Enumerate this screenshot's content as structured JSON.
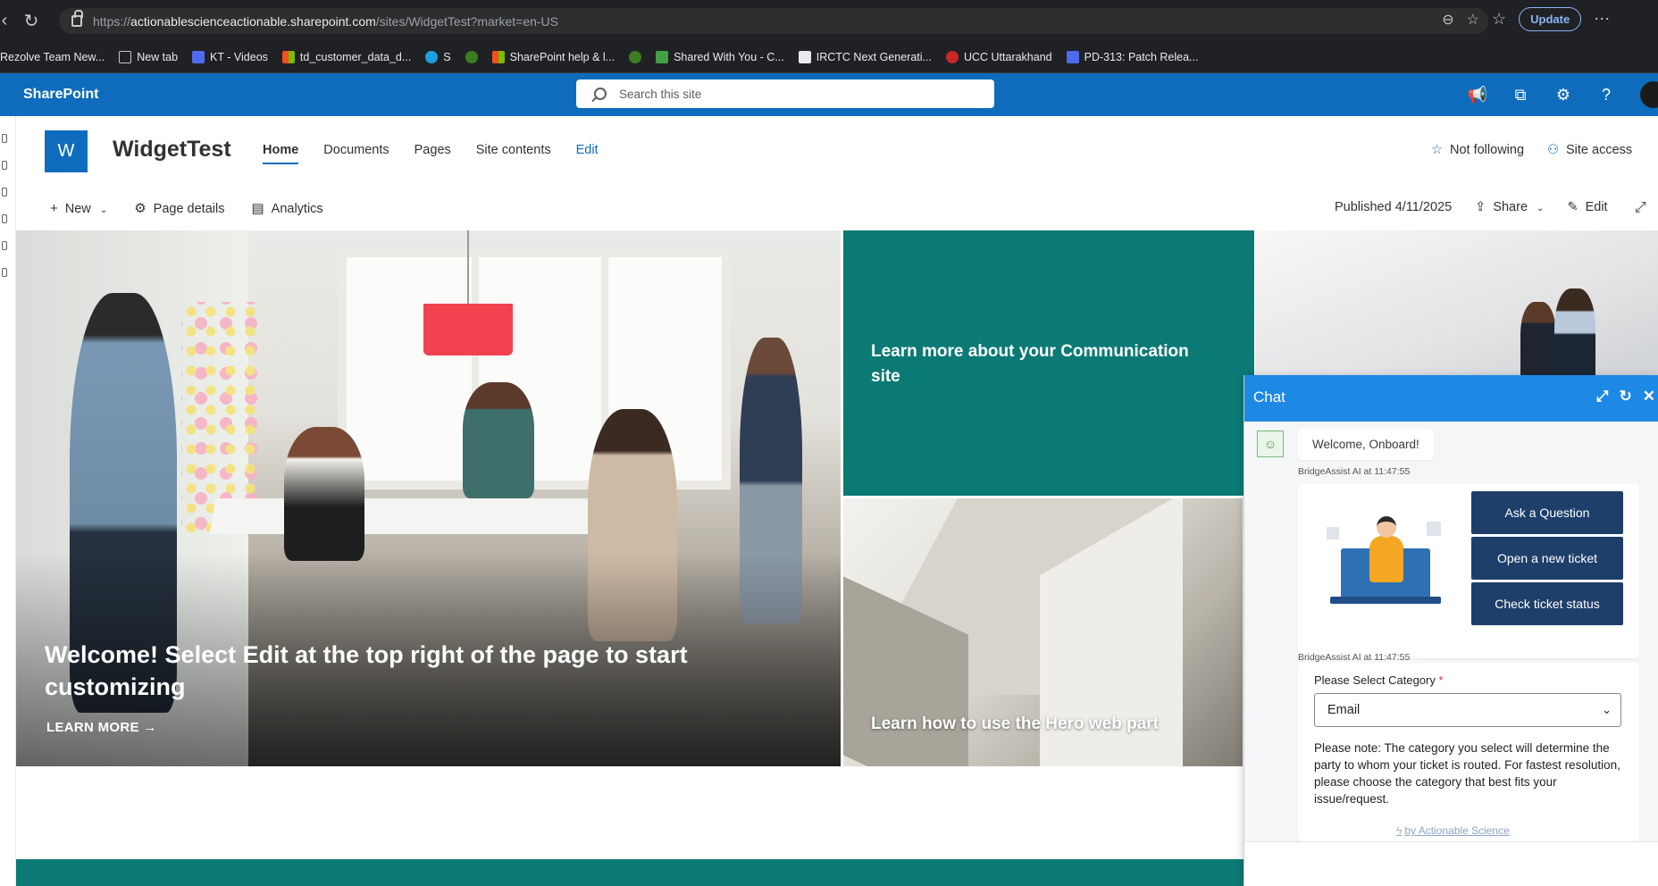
{
  "browser": {
    "url_prefix": "https://",
    "url_host": "actionablescienceactionable.sharepoint.com",
    "url_path": "/sites/WidgetTest?market=en-US",
    "update_label": "Update",
    "bookmarks": [
      {
        "label": "Rezolve Team New...",
        "color": "#4f6bed"
      },
      {
        "label": "New tab",
        "color": "#5f6368"
      },
      {
        "label": "KT - Videos",
        "color": "#4f6bed"
      },
      {
        "label": "td_customer_data_d...",
        "color": "#f25022"
      },
      {
        "label": "S",
        "color": "#1ba1e2"
      },
      {
        "label": "",
        "color": "#3c7d22"
      },
      {
        "label": "SharePoint help & l...",
        "color": "#f25022"
      },
      {
        "label": "",
        "color": "#3c7d22"
      },
      {
        "label": "Shared With You - C...",
        "color": "#43a047"
      },
      {
        "label": "IRCTC Next Generati...",
        "color": "#e8eaed"
      },
      {
        "label": "UCC Uttarakhand",
        "color": "#c62828"
      },
      {
        "label": "PD-313: Patch Relea...",
        "color": "#4f6bed"
      }
    ]
  },
  "suite": {
    "brand": "SharePoint",
    "search_placeholder": "Search this site"
  },
  "site": {
    "logo_letter": "W",
    "title": "WidgetTest",
    "nav": [
      {
        "label": "Home"
      },
      {
        "label": "Documents"
      },
      {
        "label": "Pages"
      },
      {
        "label": "Site contents"
      },
      {
        "label": "Edit"
      }
    ],
    "follow_label": "Not following",
    "access_label": "Site access"
  },
  "command_bar": {
    "new_label": "New",
    "page_details_label": "Page details",
    "analytics_label": "Analytics",
    "published_label": "Published 4/11/2025",
    "share_label": "Share",
    "edit_label": "Edit"
  },
  "hero": {
    "main_title": "Welcome! Select Edit at the top right of the page to start customizing",
    "main_link": "LEARN MORE",
    "tile_teal": "Learn more about your Communication site",
    "tile_arch": "Learn how to use the Hero web part"
  },
  "chat": {
    "title": "Chat",
    "welcome": "Welcome, Onboard!",
    "meta1": "BridgeAssist AI at 11:47:55",
    "meta2": "BridgeAssist AI at 11:47:55",
    "options": [
      "Ask a Question",
      "Open a new ticket",
      "Check ticket status"
    ],
    "form_label": "Please Select Category",
    "form_required": "*",
    "select_value": "Email",
    "note": "Please note: The category you select will determine the party to whom your ticket is routed. For fastest resolution, please choose the category that best fits your issue/request.",
    "powered_by": "by Actionable Science"
  }
}
